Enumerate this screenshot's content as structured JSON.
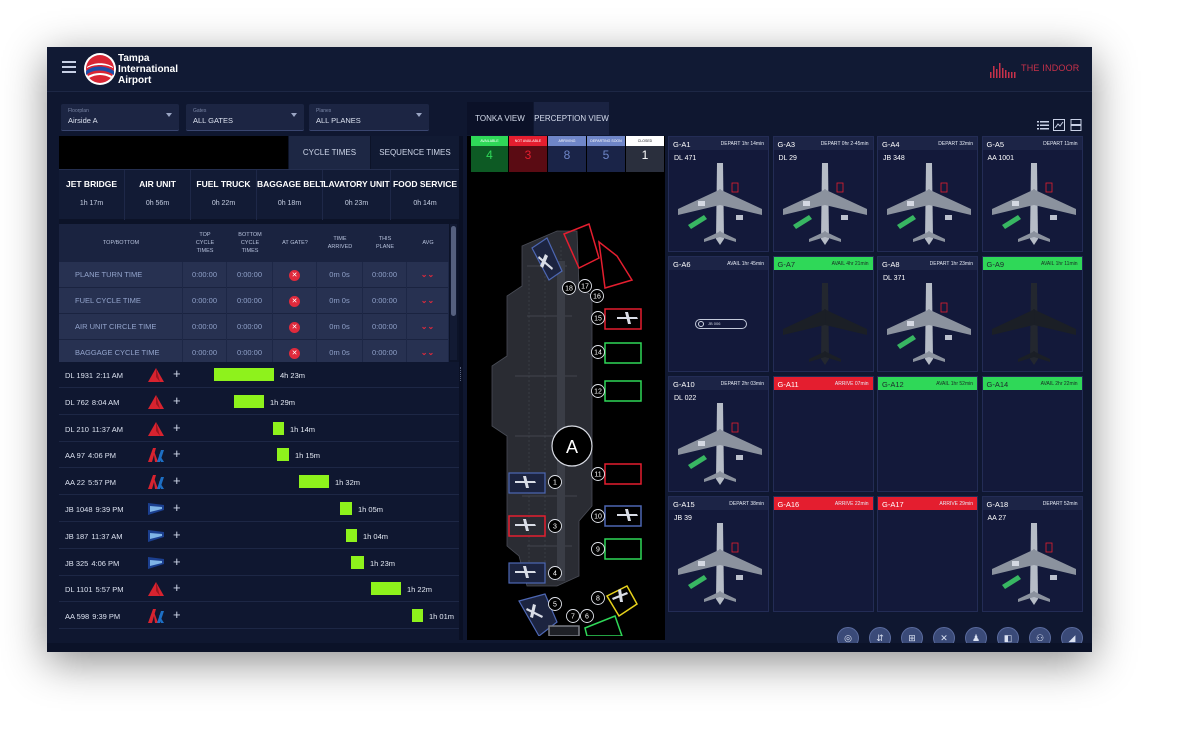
{
  "header": {
    "airport_name": [
      "Tampa",
      "International",
      "Airport"
    ],
    "brand": "THE INDOOR"
  },
  "filters": [
    {
      "label": "Floorplan",
      "value": "Airside A"
    },
    {
      "label": "Gates",
      "value": "ALL GATES"
    },
    {
      "label": "Planes",
      "value": "ALL PLANES"
    }
  ],
  "time_tabs": [
    "CYCLE TIMES",
    "SEQUENCE TIMES"
  ],
  "cycle_summary": [
    {
      "name": "JET BRIDGE",
      "value": "1h 17m"
    },
    {
      "name": "AIR UNIT",
      "value": "0h 56m"
    },
    {
      "name": "FUEL TRUCK",
      "value": "0h 22m"
    },
    {
      "name": "BAGGAGE BELT",
      "value": "0h 18m"
    },
    {
      "name": "LAVATORY UNIT",
      "value": "0h 23m"
    },
    {
      "name": "FOOD SERVICE",
      "value": "0h 14m"
    }
  ],
  "table": {
    "headers": [
      "TOP/BOTTOM",
      "TOP\nCYCLE\nTIMES",
      "BOTTOM\nCYCLE\nTIMES",
      "AT GATE?",
      "TIME\nARRIVED",
      "THIS\nPLANE",
      "AVG"
    ],
    "rows": [
      {
        "name": "PLANE TURN TIME",
        "top": "0:00:00",
        "bottom": "0:00:00",
        "arrived": "0m 0s",
        "plane": "0:00:00"
      },
      {
        "name": "FUEL CYCLE TIME",
        "top": "0:00:00",
        "bottom": "0:00:00",
        "arrived": "0m 0s",
        "plane": "0:00:00"
      },
      {
        "name": "AIR UNIT CIRCLE TIME",
        "top": "0:00:00",
        "bottom": "0:00:00",
        "arrived": "0m 0s",
        "plane": "0:00:00"
      },
      {
        "name": "BAGGAGE CYCLE TIME",
        "top": "0:00:00",
        "bottom": "0:00:00",
        "arrived": "0m 0s",
        "plane": "0:00:00"
      }
    ]
  },
  "flights": [
    {
      "id": "DL 1931",
      "time": "2:11 AM",
      "airline": "delta",
      "duration": "4h 23m"
    },
    {
      "id": "DL 762",
      "time": "8:04 AM",
      "airline": "delta",
      "duration": "1h 29m"
    },
    {
      "id": "DL 210",
      "time": "11:37 AM",
      "airline": "delta",
      "duration": "1h 14m"
    },
    {
      "id": "AA 97",
      "time": "4:06 PM",
      "airline": "american",
      "duration": "1h 15m"
    },
    {
      "id": "AA 22",
      "time": "5:57 PM",
      "airline": "american",
      "duration": "1h 32m"
    },
    {
      "id": "JB 1048",
      "time": "9:39 PM",
      "airline": "jetblue",
      "duration": "1h 05m"
    },
    {
      "id": "JB 187",
      "time": "11:37 AM",
      "airline": "jetblue",
      "duration": "1h 04m"
    },
    {
      "id": "JB 325",
      "time": "4:06 PM",
      "airline": "jetblue",
      "duration": "1h 23m"
    },
    {
      "id": "DL 1101",
      "time": "5:57 PM",
      "airline": "delta",
      "duration": "1h 22m"
    },
    {
      "id": "AA 598",
      "time": "9:39 PM",
      "airline": "american",
      "duration": "1h 01m"
    }
  ],
  "view_tabs": [
    "TONKA VIEW",
    "PERCEPTION VIEW"
  ],
  "status_counts": [
    {
      "label": "AVAILABLE",
      "value": "4",
      "color": "#2fd858",
      "bg": "#0d5a24"
    },
    {
      "label": "NOT AVAILABLE",
      "value": "3",
      "color": "#e41e2f",
      "bg": "#5a0b13"
    },
    {
      "label": "ARRIVING",
      "value": "8",
      "color": "#6f86c8",
      "bg": "#1a2448"
    },
    {
      "label": "DEPARTING SOON",
      "value": "5",
      "color": "#6f86c8",
      "bg": "#1a2448"
    },
    {
      "label": "CLOSED",
      "value": "1",
      "color": "#ffffff",
      "bg": "#2a2f3d"
    }
  ],
  "concourse_label": "A",
  "gate_numbers": [
    "18",
    "17",
    "16",
    "15",
    "14",
    "12",
    "11",
    "10",
    "9",
    "8",
    "7",
    "6",
    "5",
    "4",
    "3",
    "1"
  ],
  "gates": [
    {
      "name": "G-A1",
      "status": "DEPART 1hr 14min",
      "flight": "DL 471",
      "type": "default",
      "plane": true
    },
    {
      "name": "G-A3",
      "status": "DEPART 0hr 2-45min",
      "flight": "DL 29",
      "type": "default",
      "plane": true
    },
    {
      "name": "G-A4",
      "status": "DEPART 32min",
      "flight": "JB 348",
      "type": "default",
      "plane": true
    },
    {
      "name": "G-A5",
      "status": "DEPART 11min",
      "flight": "AA 1001",
      "type": "default",
      "plane": true
    },
    {
      "name": "G-A6",
      "status": "AVAIL 1hr 45min",
      "flight": "",
      "type": "default",
      "plane": false,
      "pill": "JB 006"
    },
    {
      "name": "G-A7",
      "status": "AVAIL 4hr 21min",
      "flight": "",
      "type": "green",
      "plane": "ghost"
    },
    {
      "name": "G-A8",
      "status": "DEPART 1hr 23min",
      "flight": "DL 371",
      "type": "default",
      "plane": true
    },
    {
      "name": "G-A9",
      "status": "AVAIL 1hr 11min",
      "flight": "",
      "type": "green",
      "plane": "ghost"
    },
    {
      "name": "G-A10",
      "status": "DEPART 2hr 03min",
      "flight": "DL 022",
      "type": "default",
      "plane": true
    },
    {
      "name": "G-A11",
      "status": "ARRIVE 07min",
      "flight": "",
      "type": "red",
      "plane": false
    },
    {
      "name": "G-A12",
      "status": "AVAIL 1hr 52min",
      "flight": "",
      "type": "green",
      "plane": false
    },
    {
      "name": "G-A14",
      "status": "AVAIL 2hr 22min",
      "flight": "",
      "type": "green",
      "plane": false
    },
    {
      "name": "G-A15",
      "status": "DEPART 38min",
      "flight": "JB 39",
      "type": "default",
      "plane": true
    },
    {
      "name": "G-A16",
      "status": "ARRIVE 22min",
      "flight": "",
      "type": "red",
      "plane": false
    },
    {
      "name": "G-A17",
      "status": "ARRIVE 29min",
      "flight": "",
      "type": "red",
      "plane": false
    },
    {
      "name": "G-A18",
      "status": "DEPART 52min",
      "flight": "AA 27",
      "type": "default",
      "plane": true
    }
  ],
  "tools": [
    "chat-icon",
    "jet-bridge-icon",
    "baggage-icon",
    "fuel-icon",
    "lavatory-icon",
    "air-unit-icon",
    "staff-icon",
    "plane-icon"
  ]
}
